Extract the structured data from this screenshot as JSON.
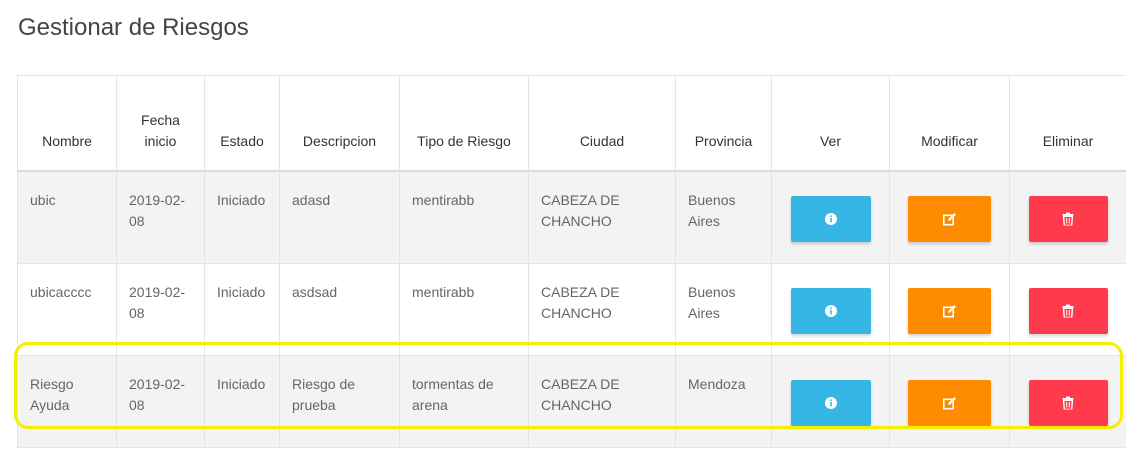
{
  "page": {
    "title": "Gestionar de Riesgos"
  },
  "table": {
    "headers": {
      "nombre": "Nombre",
      "fecha_line1": "Fecha",
      "fecha_line2": "inicio",
      "estado": "Estado",
      "descripcion": "Descripcion",
      "tipo": "Tipo de Riesgo",
      "ciudad": "Ciudad",
      "provincia": "Provincia",
      "ver": "Ver",
      "modificar": "Modificar",
      "eliminar": "Eliminar"
    },
    "rows": [
      {
        "nombre": "ubic",
        "fecha_a": "2019-02-",
        "fecha_b": "08",
        "estado": "Iniciado",
        "desc_a": "adasd",
        "desc_b": "",
        "tipo_a": "mentirabb",
        "tipo_b": "",
        "ciudad_a": "CABEZA DE",
        "ciudad_b": "CHANCHO",
        "prov_a": "Buenos",
        "prov_b": "Aires"
      },
      {
        "nombre": "ubicacccc",
        "fecha_a": "2019-02-",
        "fecha_b": "08",
        "estado": "Iniciado",
        "desc_a": "asdsad",
        "desc_b": "",
        "tipo_a": "mentirabb",
        "tipo_b": "",
        "ciudad_a": "CABEZA DE",
        "ciudad_b": "CHANCHO",
        "prov_a": "Buenos",
        "prov_b": "Aires"
      },
      {
        "nombre_a": "Riesgo",
        "nombre_b": "Ayuda",
        "fecha_a": "2019-02-",
        "fecha_b": "08",
        "estado": "Iniciado",
        "desc_a": "Riesgo de",
        "desc_b": "prueba",
        "tipo_a": "tormentas de",
        "tipo_b": "arena",
        "ciudad_a": "CABEZA DE",
        "ciudad_b": "CHANCHO",
        "prov_a": "Mendoza",
        "prov_b": ""
      }
    ]
  },
  "icons": {
    "ver": "info-icon",
    "modificar": "edit-icon",
    "eliminar": "trash-icon"
  },
  "colors": {
    "ver": "#35b6e5",
    "modificar": "#ff8c00",
    "eliminar": "#ff3a4d",
    "highlight": "#f5ee00"
  }
}
